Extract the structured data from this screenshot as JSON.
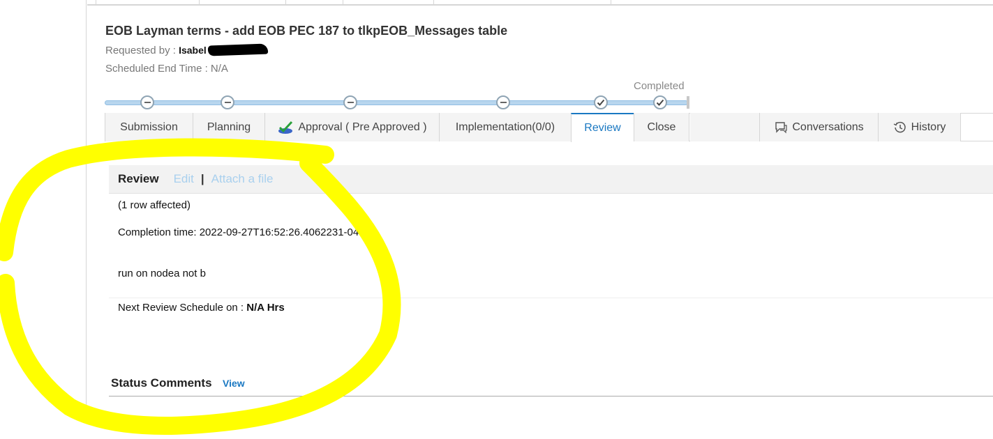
{
  "ticket": {
    "title": "EOB Layman terms - add EOB PEC 187 to tlkpEOB_Messages table",
    "requested_by_label": "Requested by : ",
    "requested_by_name": "Isabel",
    "scheduled_end_label": "Scheduled End Time : N/A"
  },
  "progress": {
    "label": "Completed",
    "stages_completed": 2,
    "stages_total": 6
  },
  "tabs": {
    "submission": "Submission",
    "planning": "Planning",
    "approval": "Approval ( Pre Approved )",
    "implementation": "Implementation(0/0)",
    "review": "Review",
    "close": "Close",
    "conversations": "Conversations",
    "history": "History"
  },
  "review": {
    "heading": "Review",
    "edit": "Edit",
    "separator": "|",
    "attach": "Attach a file",
    "line1": "(1 row affected)",
    "line2": "Completion time: 2022-09-27T16:52:26.4062231-04:00",
    "line3": "run on nodea not b",
    "next_label": "Next Review Schedule on : ",
    "next_value": "N/A Hrs"
  },
  "status_comments": {
    "label": "Status Comments",
    "view": "View"
  },
  "colors": {
    "accent": "#1a78c2",
    "highlight": "#ffff00"
  }
}
